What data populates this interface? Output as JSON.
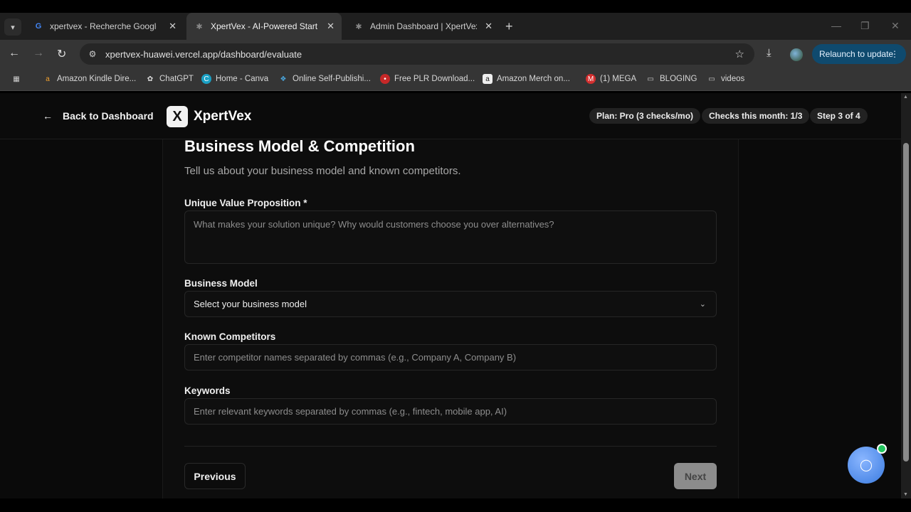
{
  "browser": {
    "tabs": [
      {
        "title": "xpertvex - Recherche Google",
        "active": false
      },
      {
        "title": "XpertVex - AI-Powered Startup",
        "active": true
      },
      {
        "title": "Admin Dashboard | XpertVex | X",
        "active": false
      }
    ],
    "url": "xpertvex-huawei.vercel.app/dashboard/evaluate",
    "relaunch_label": "Relaunch to update",
    "bookmarks": [
      "Amazon Kindle Dire...",
      "ChatGPT",
      "Home - Canva",
      "Online Self-Publishi...",
      "Free PLR Download...",
      "Amazon Merch on...",
      "(1) MEGA",
      "BLOGING",
      "videos"
    ]
  },
  "header": {
    "back_label": "Back to Dashboard",
    "logo_mark": "X",
    "logo_name": "XpertVex",
    "plan": "Plan: Pro (3 checks/mo)",
    "checks": "Checks this month: 1/3",
    "step": "Step 3 of 4"
  },
  "form": {
    "title": "Business Model & Competition",
    "subtitle": "Tell us about your business model and known competitors.",
    "uvp_label": "Unique Value Proposition *",
    "uvp_placeholder": "What makes your solution unique? Why would customers choose you over alternatives?",
    "model_label": "Business Model",
    "model_value": "Select your business model",
    "competitors_label": "Known Competitors",
    "competitors_placeholder": "Enter competitor names separated by commas (e.g., Company A, Company B)",
    "keywords_label": "Keywords",
    "keywords_placeholder": "Enter relevant keywords separated by commas (e.g., fintech, mobile app, AI)",
    "previous_label": "Previous",
    "next_label": "Next"
  },
  "colors": {
    "background": "#0a0a0a",
    "relaunch_bg": "#0f4a6e",
    "chat_bubble": "#3a7be0",
    "online_dot": "#22c55e"
  }
}
